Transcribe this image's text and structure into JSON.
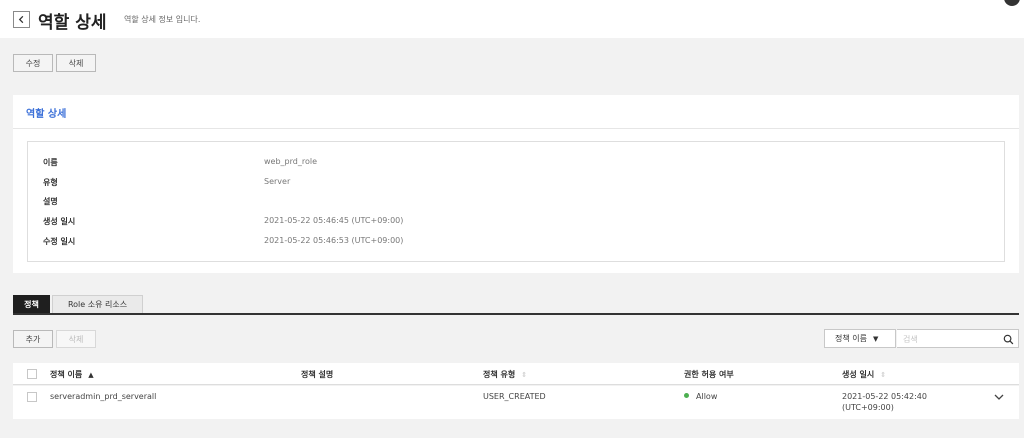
{
  "header": {
    "title": "역할 상세",
    "subtitle": "역할 상세 정보 입니다."
  },
  "actions": {
    "edit_label": "수정",
    "delete_label": "삭제"
  },
  "detail_panel": {
    "title": "역할 상세",
    "fields": [
      {
        "label": "이름",
        "value": "web_prd_role"
      },
      {
        "label": "유형",
        "value": "Server"
      },
      {
        "label": "설명",
        "value": ""
      },
      {
        "label": "생성 일시",
        "value": "2021-05-22 05:46:45 (UTC+09:00)"
      },
      {
        "label": "수정 일시",
        "value": "2021-05-22 05:46:53 (UTC+09:00)"
      }
    ]
  },
  "tabs": [
    {
      "label": "정책",
      "active": true
    },
    {
      "label": "Role 소유 리소스",
      "active": false
    }
  ],
  "policy_toolbar": {
    "add_label": "추가",
    "delete_label": "삭제",
    "filter_selected": "정책 이름",
    "search_placeholder": "검색"
  },
  "policy_table": {
    "columns": [
      "정책 이름",
      "정책 설명",
      "정책 유형",
      "권한 허용 여부",
      "생성 일시"
    ],
    "rows": [
      {
        "name": "serveradmin_prd_serverall",
        "description": "",
        "type": "USER_CREATED",
        "permission": "Allow",
        "created_date": "2021-05-22 05:42:40",
        "created_tz": "(UTC+09:00)"
      }
    ]
  },
  "colors": {
    "accent": "#3a6fd8",
    "tab_active": "#1f1f1f",
    "allow_status": "#4caf50"
  },
  "icons": [
    "chevron-left-icon",
    "caret-down-icon",
    "search-icon",
    "sort-asc-icon",
    "sort-both-icon",
    "chevron-down-icon"
  ]
}
